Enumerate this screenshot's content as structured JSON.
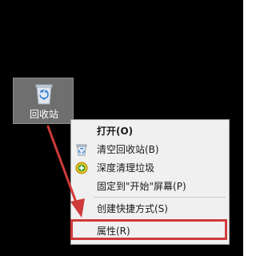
{
  "desktop": {
    "recycle_bin_label": "回收站"
  },
  "context_menu": {
    "items": [
      {
        "label": "打开(O)",
        "icon": "none",
        "bold": true
      },
      {
        "label": "清空回收站(B)",
        "icon": "recycle-bin-icon"
      },
      {
        "label": "深度清理垃圾",
        "icon": "deep-clean-icon"
      },
      {
        "label": "固定到\"开始\"屏幕(P)",
        "icon": "none"
      },
      {
        "label": "创建快捷方式(S)",
        "icon": "none"
      },
      {
        "label": "属性(R)",
        "icon": "none"
      }
    ]
  },
  "annotation": {
    "arrow_color": "#d03a3a",
    "highlight_color": "#d03a3a",
    "highlighted_item": "属性(R)"
  },
  "colors": {
    "desktop_background": "#000000",
    "menu_background": "#f0f0f0",
    "icon_selection": "#6f6f6f"
  }
}
